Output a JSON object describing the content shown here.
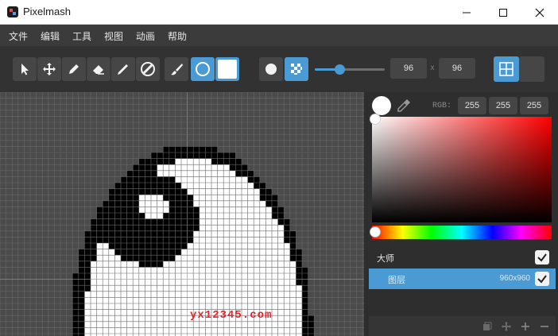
{
  "window": {
    "title": "Pixelmash"
  },
  "menu": [
    "文件",
    "编辑",
    "工具",
    "视图",
    "动画",
    "帮助"
  ],
  "toolbar": {
    "tools": [
      "select-arrow-icon",
      "move-icon",
      "pencil-icon",
      "eraser-icon",
      "line-icon",
      "fill-icon",
      "brush-icon",
      "circle-icon",
      "square-icon"
    ],
    "active_tool": "circle-icon",
    "width": "96",
    "height": "96",
    "size_separator": "x",
    "brush_size_fraction": 0.35
  },
  "color": {
    "current": "#ffffff",
    "rgb_label": "RGB:",
    "r": "255",
    "g": "255",
    "b": "255",
    "accent": "#4a9ad4"
  },
  "layers": {
    "group_label": "大师",
    "items": [
      {
        "name": "图层",
        "size": "960x960",
        "visible": true,
        "selected": true
      }
    ]
  },
  "watermark": "yx12345.com"
}
